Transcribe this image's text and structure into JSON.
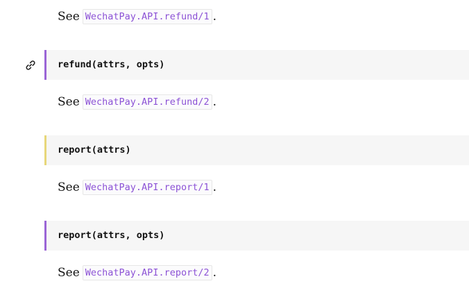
{
  "sections": [
    {
      "see_text": "See",
      "link": "WechatPay.API.refund/1",
      "period": "."
    },
    {
      "signature": "refund(attrs, opts)",
      "see_text": "See",
      "link": "WechatPay.API.refund/2",
      "period": "."
    },
    {
      "signature": "report(attrs)",
      "see_text": "See",
      "link": "WechatPay.API.report/1",
      "period": "."
    },
    {
      "signature": "report(attrs, opts)",
      "see_text": "See",
      "link": "WechatPay.API.report/2",
      "period": "."
    }
  ],
  "colors": {
    "link": "#8c52d6",
    "detail_border_purple": "#9b65d6",
    "detail_border_yellow": "#e7d77a",
    "detail_bg": "#f6f6f6"
  },
  "icons": {
    "anchor": "link-icon"
  }
}
